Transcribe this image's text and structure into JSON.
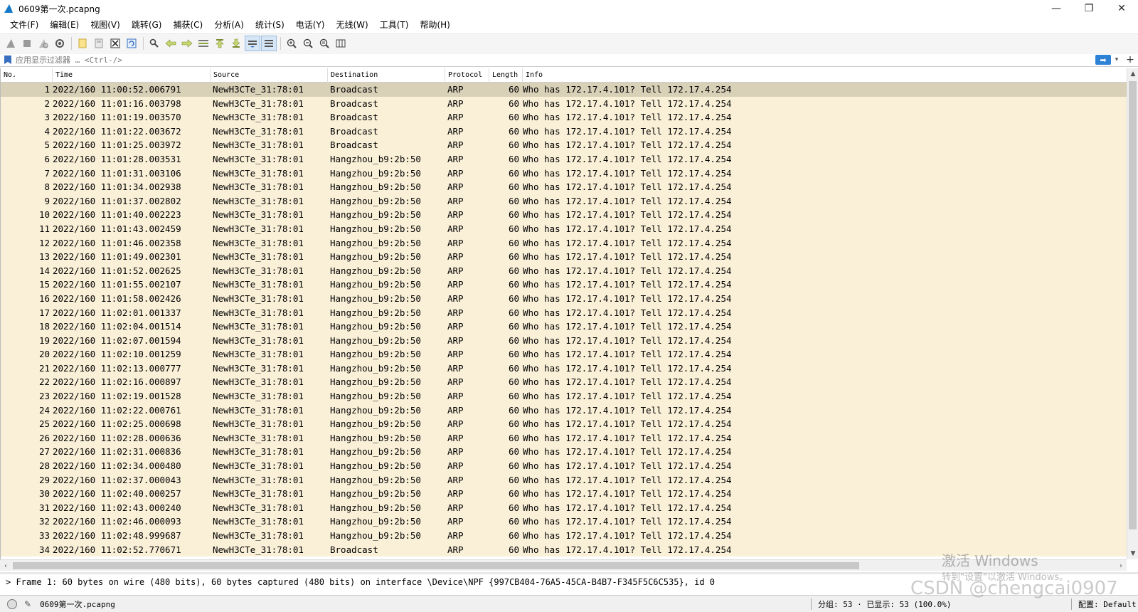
{
  "window": {
    "title": "0609第一次.pcapng",
    "minimize": "—",
    "restore": "❐",
    "close": "✕"
  },
  "menubar": [
    "文件(F)",
    "编辑(E)",
    "视图(V)",
    "跳转(G)",
    "捕获(C)",
    "分析(A)",
    "统计(S)",
    "电话(Y)",
    "无线(W)",
    "工具(T)",
    "帮助(H)"
  ],
  "toolbar": {
    "icons": [
      "shark-start-icon",
      "stop-icon",
      "restart-icon",
      "capture-options-icon",
      "open-file-icon",
      "save-file-icon",
      "close-file-icon",
      "reload-icon",
      "find-icon",
      "back-icon",
      "forward-icon",
      "goto-packet-icon",
      "first-packet-icon",
      "last-packet-icon",
      "auto-scroll-icon",
      "colorize-icon",
      "zoom-in-icon",
      "zoom-out-icon",
      "normal-size-icon",
      "resize-columns-icon"
    ]
  },
  "filter": {
    "placeholder": "应用显示过滤器 … <Ctrl-/>",
    "apply": "➡",
    "dropdown": "▾",
    "add": "+"
  },
  "columns": [
    "No.",
    "Time",
    "Source",
    "Destination",
    "Protocol",
    "Length",
    "Info"
  ],
  "packets": [
    {
      "no": "1",
      "time": "2022/160 11:00:52.006791",
      "src": "NewH3CTe_31:78:01",
      "dst": "Broadcast",
      "proto": "ARP",
      "len": "60",
      "info": "Who has 172.17.4.101? Tell 172.17.4.254"
    },
    {
      "no": "2",
      "time": "2022/160 11:01:16.003798",
      "src": "NewH3CTe_31:78:01",
      "dst": "Broadcast",
      "proto": "ARP",
      "len": "60",
      "info": "Who has 172.17.4.101? Tell 172.17.4.254"
    },
    {
      "no": "3",
      "time": "2022/160 11:01:19.003570",
      "src": "NewH3CTe_31:78:01",
      "dst": "Broadcast",
      "proto": "ARP",
      "len": "60",
      "info": "Who has 172.17.4.101? Tell 172.17.4.254"
    },
    {
      "no": "4",
      "time": "2022/160 11:01:22.003672",
      "src": "NewH3CTe_31:78:01",
      "dst": "Broadcast",
      "proto": "ARP",
      "len": "60",
      "info": "Who has 172.17.4.101? Tell 172.17.4.254"
    },
    {
      "no": "5",
      "time": "2022/160 11:01:25.003972",
      "src": "NewH3CTe_31:78:01",
      "dst": "Broadcast",
      "proto": "ARP",
      "len": "60",
      "info": "Who has 172.17.4.101? Tell 172.17.4.254"
    },
    {
      "no": "6",
      "time": "2022/160 11:01:28.003531",
      "src": "NewH3CTe_31:78:01",
      "dst": "Hangzhou_b9:2b:50",
      "proto": "ARP",
      "len": "60",
      "info": "Who has 172.17.4.101? Tell 172.17.4.254"
    },
    {
      "no": "7",
      "time": "2022/160 11:01:31.003106",
      "src": "NewH3CTe_31:78:01",
      "dst": "Hangzhou_b9:2b:50",
      "proto": "ARP",
      "len": "60",
      "info": "Who has 172.17.4.101? Tell 172.17.4.254"
    },
    {
      "no": "8",
      "time": "2022/160 11:01:34.002938",
      "src": "NewH3CTe_31:78:01",
      "dst": "Hangzhou_b9:2b:50",
      "proto": "ARP",
      "len": "60",
      "info": "Who has 172.17.4.101? Tell 172.17.4.254"
    },
    {
      "no": "9",
      "time": "2022/160 11:01:37.002802",
      "src": "NewH3CTe_31:78:01",
      "dst": "Hangzhou_b9:2b:50",
      "proto": "ARP",
      "len": "60",
      "info": "Who has 172.17.4.101? Tell 172.17.4.254"
    },
    {
      "no": "10",
      "time": "2022/160 11:01:40.002223",
      "src": "NewH3CTe_31:78:01",
      "dst": "Hangzhou_b9:2b:50",
      "proto": "ARP",
      "len": "60",
      "info": "Who has 172.17.4.101? Tell 172.17.4.254"
    },
    {
      "no": "11",
      "time": "2022/160 11:01:43.002459",
      "src": "NewH3CTe_31:78:01",
      "dst": "Hangzhou_b9:2b:50",
      "proto": "ARP",
      "len": "60",
      "info": "Who has 172.17.4.101? Tell 172.17.4.254"
    },
    {
      "no": "12",
      "time": "2022/160 11:01:46.002358",
      "src": "NewH3CTe_31:78:01",
      "dst": "Hangzhou_b9:2b:50",
      "proto": "ARP",
      "len": "60",
      "info": "Who has 172.17.4.101? Tell 172.17.4.254"
    },
    {
      "no": "13",
      "time": "2022/160 11:01:49.002301",
      "src": "NewH3CTe_31:78:01",
      "dst": "Hangzhou_b9:2b:50",
      "proto": "ARP",
      "len": "60",
      "info": "Who has 172.17.4.101? Tell 172.17.4.254"
    },
    {
      "no": "14",
      "time": "2022/160 11:01:52.002625",
      "src": "NewH3CTe_31:78:01",
      "dst": "Hangzhou_b9:2b:50",
      "proto": "ARP",
      "len": "60",
      "info": "Who has 172.17.4.101? Tell 172.17.4.254"
    },
    {
      "no": "15",
      "time": "2022/160 11:01:55.002107",
      "src": "NewH3CTe_31:78:01",
      "dst": "Hangzhou_b9:2b:50",
      "proto": "ARP",
      "len": "60",
      "info": "Who has 172.17.4.101? Tell 172.17.4.254"
    },
    {
      "no": "16",
      "time": "2022/160 11:01:58.002426",
      "src": "NewH3CTe_31:78:01",
      "dst": "Hangzhou_b9:2b:50",
      "proto": "ARP",
      "len": "60",
      "info": "Who has 172.17.4.101? Tell 172.17.4.254"
    },
    {
      "no": "17",
      "time": "2022/160 11:02:01.001337",
      "src": "NewH3CTe_31:78:01",
      "dst": "Hangzhou_b9:2b:50",
      "proto": "ARP",
      "len": "60",
      "info": "Who has 172.17.4.101? Tell 172.17.4.254"
    },
    {
      "no": "18",
      "time": "2022/160 11:02:04.001514",
      "src": "NewH3CTe_31:78:01",
      "dst": "Hangzhou_b9:2b:50",
      "proto": "ARP",
      "len": "60",
      "info": "Who has 172.17.4.101? Tell 172.17.4.254"
    },
    {
      "no": "19",
      "time": "2022/160 11:02:07.001594",
      "src": "NewH3CTe_31:78:01",
      "dst": "Hangzhou_b9:2b:50",
      "proto": "ARP",
      "len": "60",
      "info": "Who has 172.17.4.101? Tell 172.17.4.254"
    },
    {
      "no": "20",
      "time": "2022/160 11:02:10.001259",
      "src": "NewH3CTe_31:78:01",
      "dst": "Hangzhou_b9:2b:50",
      "proto": "ARP",
      "len": "60",
      "info": "Who has 172.17.4.101? Tell 172.17.4.254"
    },
    {
      "no": "21",
      "time": "2022/160 11:02:13.000777",
      "src": "NewH3CTe_31:78:01",
      "dst": "Hangzhou_b9:2b:50",
      "proto": "ARP",
      "len": "60",
      "info": "Who has 172.17.4.101? Tell 172.17.4.254"
    },
    {
      "no": "22",
      "time": "2022/160 11:02:16.000897",
      "src": "NewH3CTe_31:78:01",
      "dst": "Hangzhou_b9:2b:50",
      "proto": "ARP",
      "len": "60",
      "info": "Who has 172.17.4.101? Tell 172.17.4.254"
    },
    {
      "no": "23",
      "time": "2022/160 11:02:19.001528",
      "src": "NewH3CTe_31:78:01",
      "dst": "Hangzhou_b9:2b:50",
      "proto": "ARP",
      "len": "60",
      "info": "Who has 172.17.4.101? Tell 172.17.4.254"
    },
    {
      "no": "24",
      "time": "2022/160 11:02:22.000761",
      "src": "NewH3CTe_31:78:01",
      "dst": "Hangzhou_b9:2b:50",
      "proto": "ARP",
      "len": "60",
      "info": "Who has 172.17.4.101? Tell 172.17.4.254"
    },
    {
      "no": "25",
      "time": "2022/160 11:02:25.000698",
      "src": "NewH3CTe_31:78:01",
      "dst": "Hangzhou_b9:2b:50",
      "proto": "ARP",
      "len": "60",
      "info": "Who has 172.17.4.101? Tell 172.17.4.254"
    },
    {
      "no": "26",
      "time": "2022/160 11:02:28.000636",
      "src": "NewH3CTe_31:78:01",
      "dst": "Hangzhou_b9:2b:50",
      "proto": "ARP",
      "len": "60",
      "info": "Who has 172.17.4.101? Tell 172.17.4.254"
    },
    {
      "no": "27",
      "time": "2022/160 11:02:31.000836",
      "src": "NewH3CTe_31:78:01",
      "dst": "Hangzhou_b9:2b:50",
      "proto": "ARP",
      "len": "60",
      "info": "Who has 172.17.4.101? Tell 172.17.4.254"
    },
    {
      "no": "28",
      "time": "2022/160 11:02:34.000480",
      "src": "NewH3CTe_31:78:01",
      "dst": "Hangzhou_b9:2b:50",
      "proto": "ARP",
      "len": "60",
      "info": "Who has 172.17.4.101? Tell 172.17.4.254"
    },
    {
      "no": "29",
      "time": "2022/160 11:02:37.000043",
      "src": "NewH3CTe_31:78:01",
      "dst": "Hangzhou_b9:2b:50",
      "proto": "ARP",
      "len": "60",
      "info": "Who has 172.17.4.101? Tell 172.17.4.254"
    },
    {
      "no": "30",
      "time": "2022/160 11:02:40.000257",
      "src": "NewH3CTe_31:78:01",
      "dst": "Hangzhou_b9:2b:50",
      "proto": "ARP",
      "len": "60",
      "info": "Who has 172.17.4.101? Tell 172.17.4.254"
    },
    {
      "no": "31",
      "time": "2022/160 11:02:43.000240",
      "src": "NewH3CTe_31:78:01",
      "dst": "Hangzhou_b9:2b:50",
      "proto": "ARP",
      "len": "60",
      "info": "Who has 172.17.4.101? Tell 172.17.4.254"
    },
    {
      "no": "32",
      "time": "2022/160 11:02:46.000093",
      "src": "NewH3CTe_31:78:01",
      "dst": "Hangzhou_b9:2b:50",
      "proto": "ARP",
      "len": "60",
      "info": "Who has 172.17.4.101? Tell 172.17.4.254"
    },
    {
      "no": "33",
      "time": "2022/160 11:02:48.999687",
      "src": "NewH3CTe_31:78:01",
      "dst": "Hangzhou_b9:2b:50",
      "proto": "ARP",
      "len": "60",
      "info": "Who has 172.17.4.101? Tell 172.17.4.254"
    },
    {
      "no": "34",
      "time": "2022/160 11:02:52.770671",
      "src": "NewH3CTe_31:78:01",
      "dst": "Broadcast",
      "proto": "ARP",
      "len": "60",
      "info": "Who has 172.17.4.101? Tell 172.17.4.254"
    }
  ],
  "details": {
    "text": "> Frame 1: 60 bytes on wire (480 bits), 60 bytes captured (480 bits) on interface \\Device\\NPF_{997CB404-76A5-45CA-B4B7-F345F5C6C535}, id 0"
  },
  "statusbar": {
    "file": "0609第一次.pcapng",
    "counts": "分组: 53 · 已显示: 53 (100.0%)",
    "profile": "配置: Default"
  },
  "watermarks": {
    "windows": "激活 Windows",
    "windows_sub": "转到\"设置\"以激活 Windows。",
    "csdn": "CSDN @chengcai0907"
  },
  "colors": {
    "row_bg": "#faf0d8",
    "row_selected": "#d9d0b8"
  }
}
